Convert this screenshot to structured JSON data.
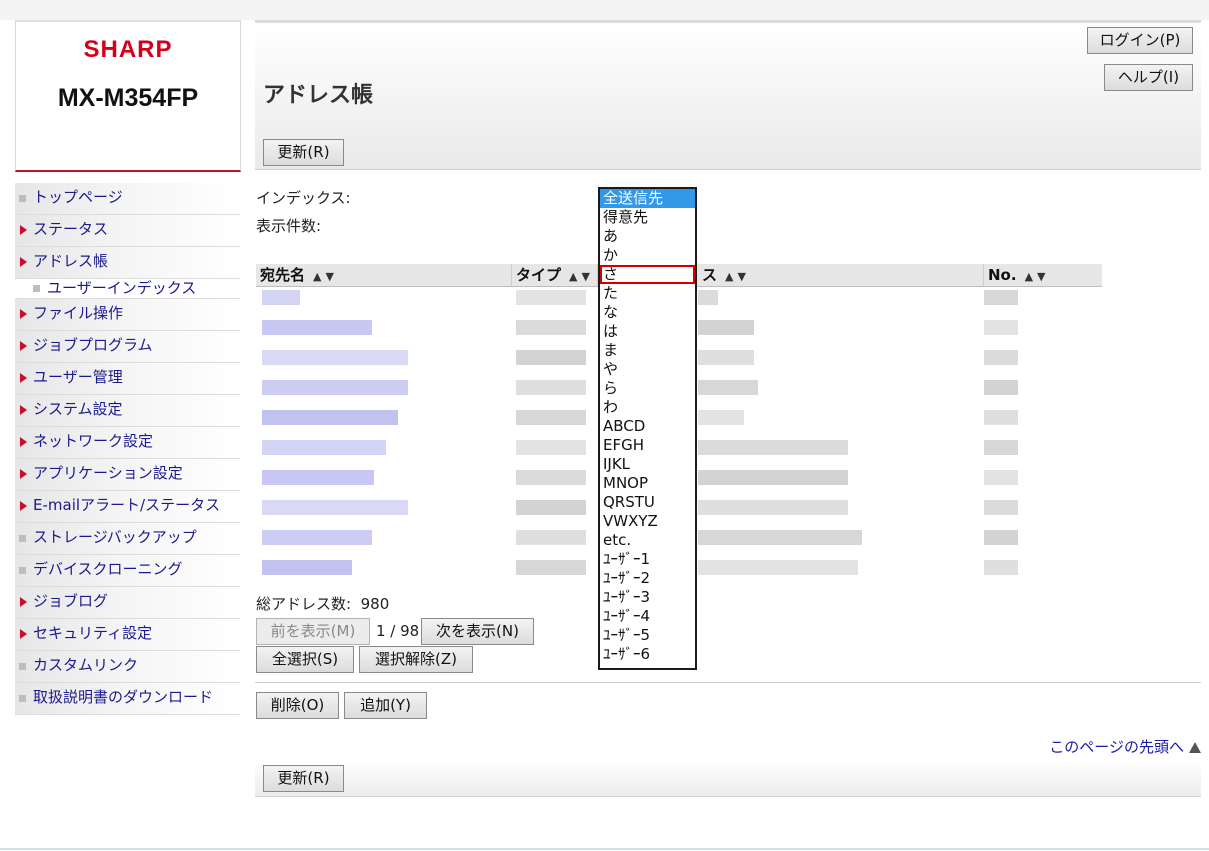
{
  "brand": {
    "logo": "SHARP",
    "model": "MX-M354FP"
  },
  "nav": [
    {
      "label": "トップページ",
      "marker": "square",
      "sub": false
    },
    {
      "label": "ステータス",
      "marker": "triangle",
      "sub": false
    },
    {
      "label": "アドレス帳",
      "marker": "triangle",
      "sub": false
    },
    {
      "label": "ユーザーインデックス",
      "marker": "square",
      "sub": true
    },
    {
      "label": "ファイル操作",
      "marker": "triangle",
      "sub": false
    },
    {
      "label": "ジョブプログラム",
      "marker": "triangle",
      "sub": false
    },
    {
      "label": "ユーザー管理",
      "marker": "triangle",
      "sub": false
    },
    {
      "label": "システム設定",
      "marker": "triangle",
      "sub": false
    },
    {
      "label": "ネットワーク設定",
      "marker": "triangle",
      "sub": false
    },
    {
      "label": "アプリケーション設定",
      "marker": "triangle",
      "sub": false
    },
    {
      "label": "E-mailアラート/ステータス",
      "marker": "triangle",
      "sub": false
    },
    {
      "label": "ストレージバックアップ",
      "marker": "square",
      "sub": false
    },
    {
      "label": "デバイスクローニング",
      "marker": "square",
      "sub": false
    },
    {
      "label": "ジョブログ",
      "marker": "triangle",
      "sub": false
    },
    {
      "label": "セキュリティ設定",
      "marker": "triangle",
      "sub": false
    },
    {
      "label": "カスタムリンク",
      "marker": "square",
      "sub": false
    },
    {
      "label": "取扱説明書のダウンロード",
      "marker": "square",
      "sub": false
    }
  ],
  "header": {
    "title": "アドレス帳",
    "login_label": "ログイン(P)",
    "help_label": "ヘルプ(I)",
    "refresh_label": "更新(R)"
  },
  "filters": {
    "index_label": "インデックス:",
    "count_label": "表示件数:"
  },
  "table": {
    "col_name": "宛先名",
    "col_type": "タイプ",
    "col_address_partial": "ス",
    "col_no": "No.",
    "sort_glyph": "▲▼"
  },
  "dropdown": {
    "options": [
      "全送信先",
      "得意先",
      "あ",
      "か",
      "さ",
      "た",
      "な",
      "は",
      "ま",
      "や",
      "ら",
      "わ",
      "ABCD",
      "EFGH",
      "IJKL",
      "MNOP",
      "QRSTU",
      "VWXYZ",
      "etc.",
      "ﾕｰｻﾞｰ1",
      "ﾕｰｻﾞｰ2",
      "ﾕｰｻﾞｰ3",
      "ﾕｰｻﾞｰ4",
      "ﾕｰｻﾞｰ5",
      "ﾕｰｻﾞｰ6"
    ],
    "selected_index": 0,
    "highlight_index": 4
  },
  "summary": {
    "total_label": "総アドレス数:",
    "total_value": "980",
    "page": "1 / 98"
  },
  "buttons": {
    "prev": "前を表示(M)",
    "next": "次を表示(N)",
    "select_all": "全選択(S)",
    "deselect": "選択解除(Z)",
    "delete": "削除(O)",
    "add": "追加(Y)",
    "refresh_bottom": "更新(R)"
  },
  "footer": {
    "top_link": "このページの先頭へ"
  }
}
